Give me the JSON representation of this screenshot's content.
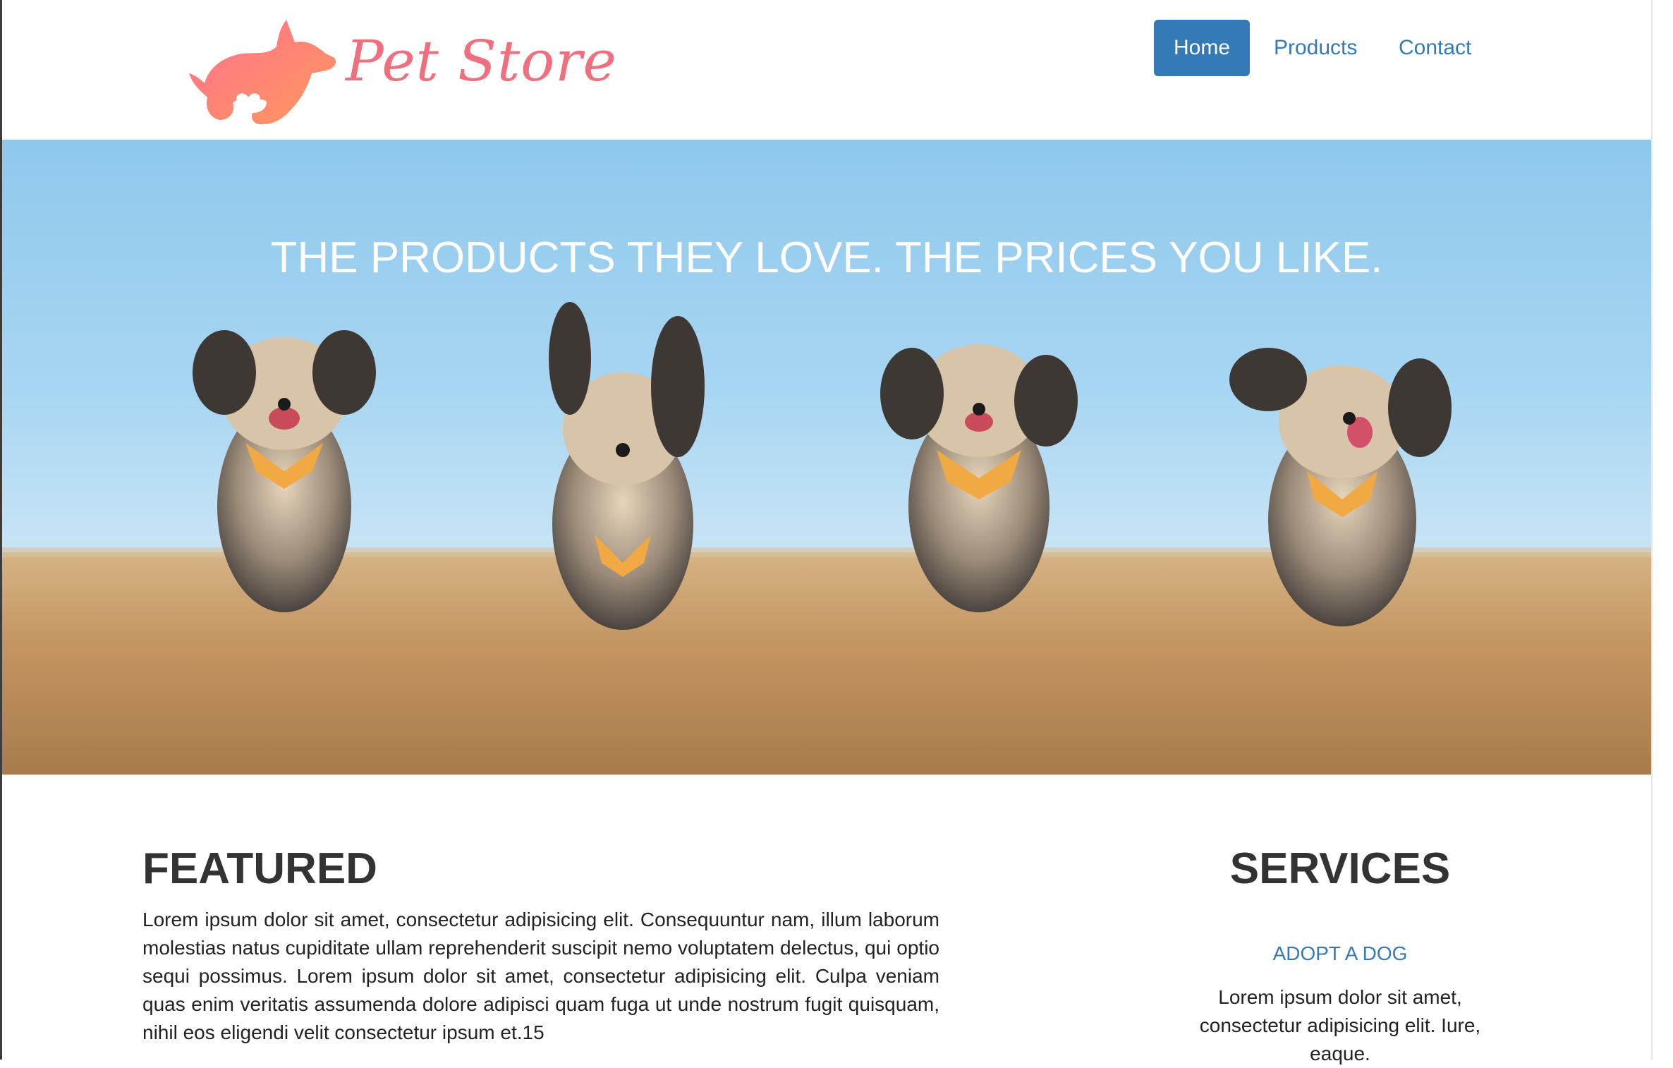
{
  "header": {
    "brand": "Pet Store",
    "nav": [
      {
        "label": "Home",
        "active": true
      },
      {
        "label": "Products",
        "active": false
      },
      {
        "label": "Contact",
        "active": false
      }
    ]
  },
  "hero": {
    "heading": "THE PRODUCTS THEY LOVE. THE PRICES YOU LIKE."
  },
  "featured": {
    "title": "FEATURED",
    "text": "Lorem ipsum dolor sit amet, consectetur adipisicing elit. Consequuntur nam, illum laborum molestias natus cupiditate ullam reprehenderit suscipit nemo voluptatem delectus, qui optio sequi possimus. Lorem ipsum dolor sit amet, consectetur adipisicing elit. Culpa veniam quas enim veritatis assumenda dolore adipisci quam fuga ut unde nostrum fugit quisquam, nihil eos eligendi velit consectetur ipsum et.15"
  },
  "services": {
    "title": "SERVICES",
    "items": [
      {
        "title": "ADOPT A DOG",
        "text": "Lorem ipsum dolor sit amet, consectetur adipisicing elit. Iure, eaque."
      }
    ]
  },
  "colors": {
    "accent": "#337ab7",
    "brand": "#ef6f7f"
  }
}
